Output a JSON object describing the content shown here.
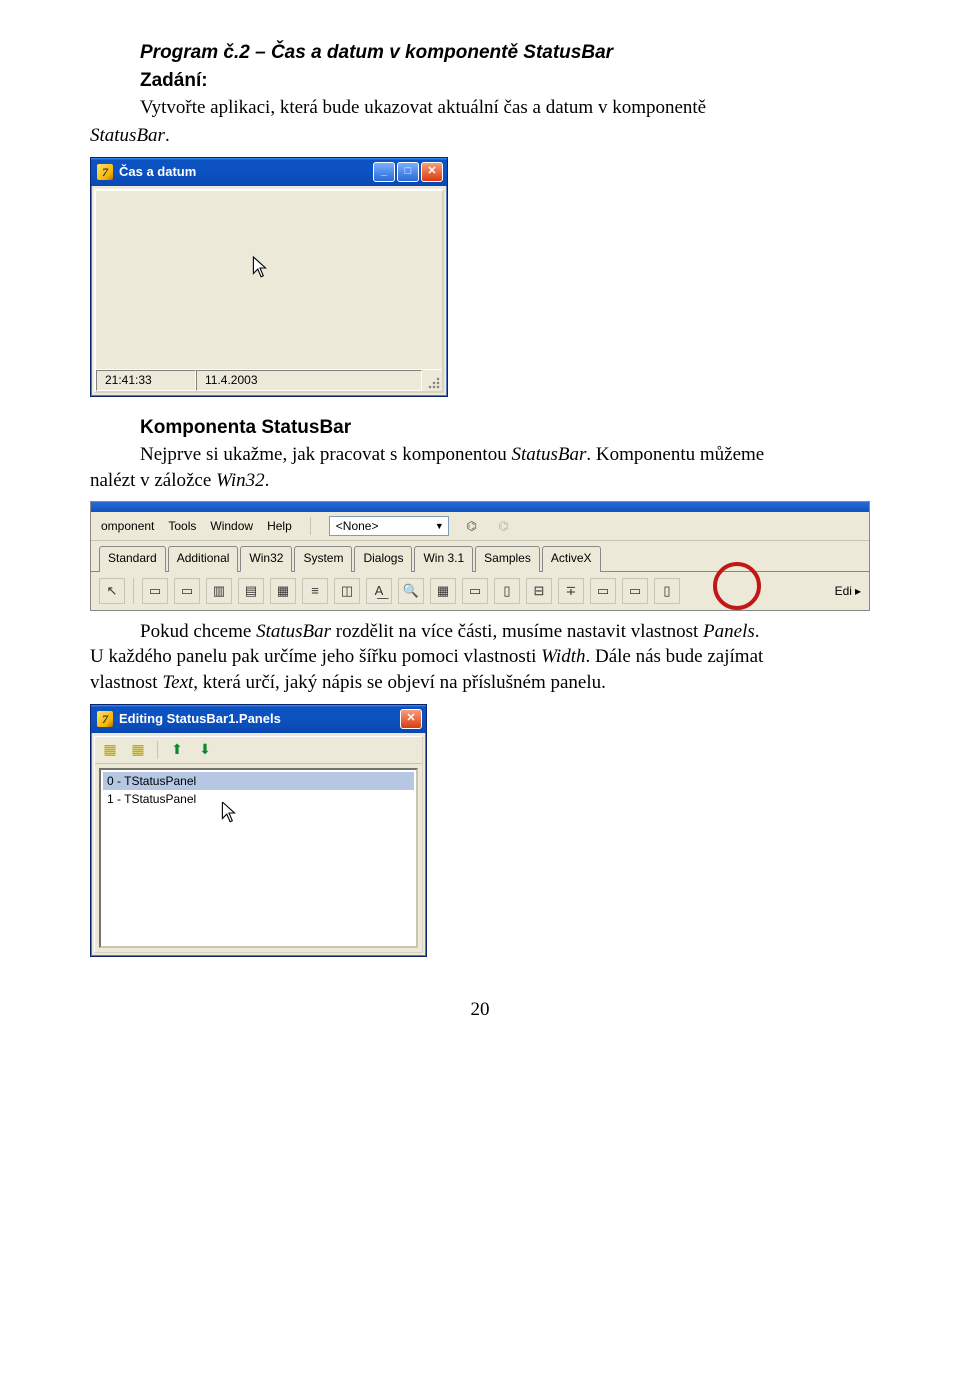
{
  "heading": {
    "program_title": "Program č.2 – Čas a datum v komponentě StatusBar",
    "zadani_label": "Zadání:",
    "zadani_text_1": "Vytvořte aplikaci, která bude ukazovat aktuální čas a datum v komponentě",
    "zadani_text_2": "StatusBar"
  },
  "window1": {
    "title": "Čas a datum",
    "status_time": "21:41:33",
    "status_date": "11.4.2003"
  },
  "section2": {
    "heading": "Komponenta StatusBar",
    "p_before": "Nejprve si ukažme, jak pracovat s komponentou ",
    "p_sb": "StatusBar",
    "p_mid": ". Komponentu můžeme",
    "p_line2": "nalézt v záložce ",
    "p_win32": "Win32",
    "p_dot": "."
  },
  "ide": {
    "menu": [
      "omponent",
      "Tools",
      "Window",
      "Help"
    ],
    "combo": "<None>",
    "tabs": [
      "Standard",
      "Additional",
      "Win32",
      "System",
      "Dialogs",
      "Win 3.1",
      "Samples",
      "ActiveX"
    ],
    "edit_label": "Edi"
  },
  "para3": {
    "t1": "Pokud chceme ",
    "i1": "StatusBar",
    "t2": " rozdělit na více části, musíme nastavit vlastnost ",
    "i2": "Panels",
    "t3": ".",
    "line2a": "U každého panelu pak určíme jeho šířku pomoci vlastnosti ",
    "i3": "Width",
    "line2b": ". Dále nás bude zajímat",
    "line3a": "vlastnost ",
    "i4": "Text",
    "line3b": ", která určí, jaký nápis se objeví na příslušném panelu."
  },
  "window3": {
    "title": "Editing StatusBar1.Panels",
    "items": [
      "0 - TStatusPanel",
      "1 - TStatusPanel"
    ]
  },
  "page_number": "20"
}
